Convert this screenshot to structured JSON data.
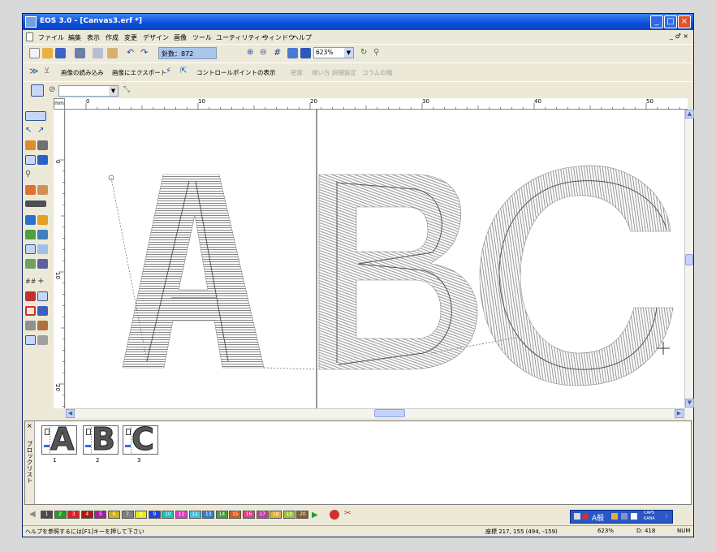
{
  "window": {
    "title": "EOS 3.0 - [Canvas3.erf *]",
    "minimize": "_",
    "maximize": "□",
    "close": "×"
  },
  "menu": {
    "items": [
      "ファイル",
      "編集",
      "表示",
      "作成",
      "変更",
      "デザイン",
      "画像",
      "ツール",
      "ユーティリティー",
      "ウィンドウ",
      "ヘルプ"
    ],
    "mdi_controls": "_ ♂ ×"
  },
  "toolbar1": {
    "stitch_count": "針数：872",
    "zoom_value": "623%"
  },
  "toolbar2": {
    "import_image": "画像の読み込み",
    "export_image": "画像にエクスポート",
    "show_control_points": "コントロールポイントの表示",
    "disabled_items": [
      "密度",
      "縫い方",
      "詳細設定",
      "コラムの幅"
    ]
  },
  "toolbar3": {
    "combo_value": ""
  },
  "ruler": {
    "corner": "mm",
    "h_labels": [
      "0",
      "10",
      "20",
      "30",
      "40",
      "50"
    ],
    "v_labels": [
      "0",
      "10",
      "20"
    ]
  },
  "block_list": {
    "close": "×",
    "title": "ブロックリスト",
    "blocks": [
      {
        "glyph": "A",
        "number": "1"
      },
      {
        "glyph": "B",
        "number": "2"
      },
      {
        "glyph": "C",
        "number": "3"
      }
    ]
  },
  "palette": {
    "swatches": [
      {
        "label": "1",
        "color": "#4a4a4a"
      },
      {
        "label": "2",
        "color": "#20a020"
      },
      {
        "label": "3",
        "color": "#e02020"
      },
      {
        "label": "4",
        "color": "#b01818"
      },
      {
        "label": "5",
        "color": "#a020a0"
      },
      {
        "label": "6",
        "color": "#d0b020"
      },
      {
        "label": "7",
        "color": "#808080"
      },
      {
        "label": "8",
        "color": "#e8e820"
      },
      {
        "label": "9",
        "color": "#2040e0"
      },
      {
        "label": "10",
        "color": "#20c0c0"
      },
      {
        "label": "11",
        "color": "#e040c0"
      },
      {
        "label": "12",
        "color": "#40c0e0"
      },
      {
        "label": "13",
        "color": "#3080d0"
      },
      {
        "label": "14",
        "color": "#40a040"
      },
      {
        "label": "15",
        "color": "#d06020"
      },
      {
        "label": "16",
        "color": "#e04080"
      },
      {
        "label": "17",
        "color": "#c040a0"
      },
      {
        "label": "18",
        "color": "#e0b030"
      },
      {
        "label": "19",
        "color": "#a0c040"
      },
      {
        "label": "20",
        "color": "#806030"
      }
    ],
    "ime_text": "A般",
    "ime_caps": "CAPS",
    "ime_kana": "KANA"
  },
  "status": {
    "help": "ヘルプを参照するには[F1]キーを押して下さい",
    "coords": "座標 217, 155 (494, -159)",
    "zoom": "623%",
    "d_value": "D: 418",
    "num": "NUM"
  },
  "colors": {
    "titlebar": "#0b4fd8",
    "chrome": "#ece9d8",
    "stitch_fill": "#8c8c8c"
  }
}
